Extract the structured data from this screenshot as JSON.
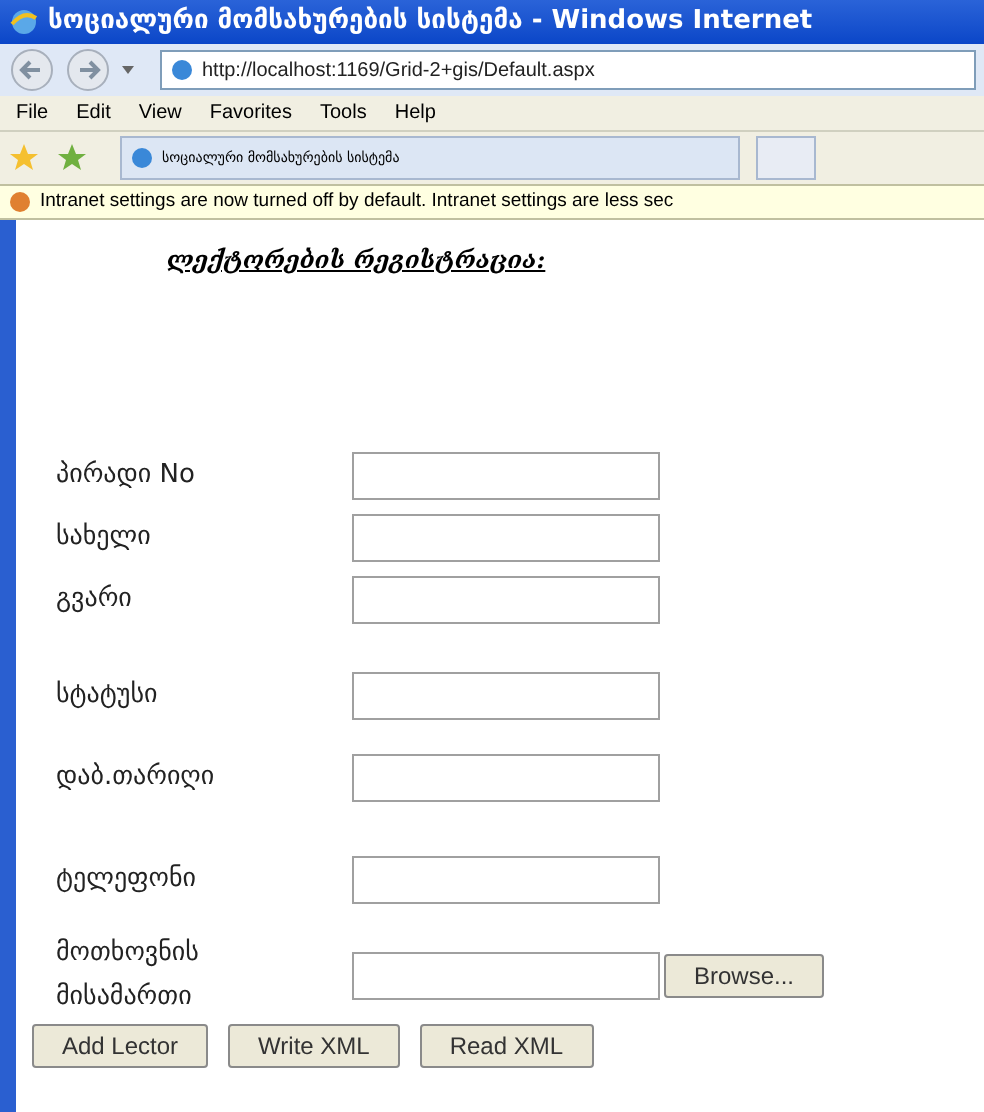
{
  "window": {
    "title": "სოციალური მომსახურების სისტემა - Windows Internet"
  },
  "address_bar": {
    "url": "http://localhost:1169/Grid-2+gis/Default.aspx"
  },
  "menu": [
    "File",
    "Edit",
    "View",
    "Favorites",
    "Tools",
    "Help"
  ],
  "tab": {
    "label": "სოციალური მომსახურების სისტემა"
  },
  "info_bar": {
    "text": "Intranet settings are now turned off by default. Intranet settings are less sec"
  },
  "form": {
    "heading": "ლექტორების რეგისტრაცია:",
    "fields": [
      {
        "label": "პირადი No",
        "kind": "text"
      },
      {
        "label": "სახელი",
        "kind": "text"
      },
      {
        "label": "გვარი",
        "kind": "text"
      },
      {
        "label": "სტატუსი",
        "kind": "text"
      },
      {
        "label": "დაბ.თარიღი",
        "kind": "text"
      },
      {
        "label": "ტელეფონი",
        "kind": "text"
      },
      {
        "label": "მოთხოვნის მისამართი",
        "kind": "file",
        "button": "Browse..."
      }
    ],
    "buttons": [
      "Add Lector",
      "Write XML",
      "Read XML"
    ]
  }
}
